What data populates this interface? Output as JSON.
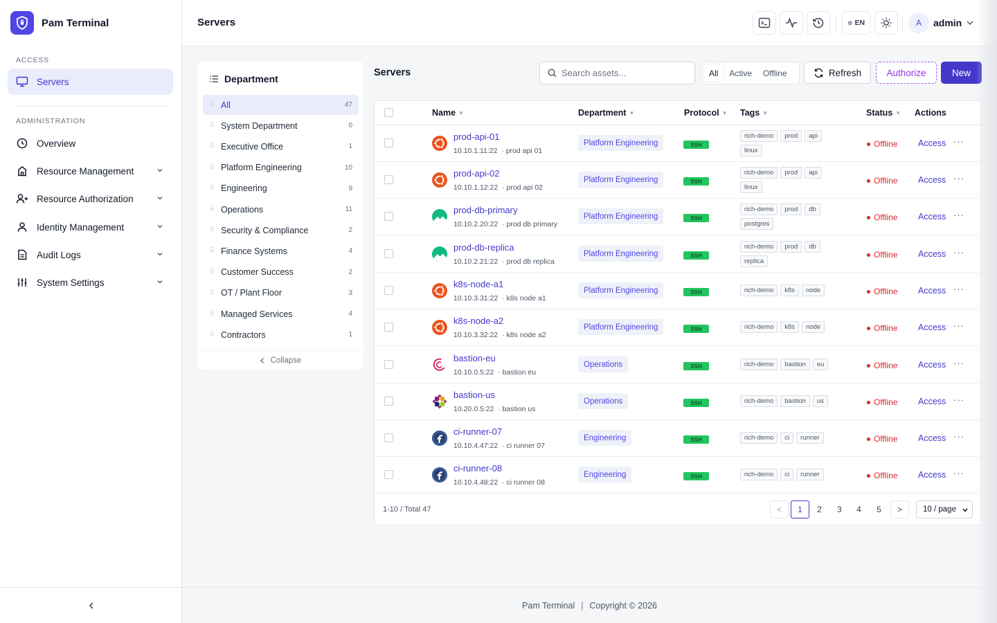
{
  "app": {
    "name": "Pam Terminal"
  },
  "sidebar": {
    "section_access": "ACCESS",
    "section_admin": "ADMINISTRATION",
    "servers_label": "Servers",
    "items": [
      {
        "label": "Overview"
      },
      {
        "label": "Resource Management"
      },
      {
        "label": "Resource Authorization"
      },
      {
        "label": "Identity Management"
      },
      {
        "label": "Audit Logs"
      },
      {
        "label": "System Settings"
      }
    ]
  },
  "header": {
    "title": "Servers",
    "lang": "EN",
    "avatar_letter": "A",
    "user": "admin"
  },
  "departments": {
    "title": "Department",
    "collapse_label": "Collapse",
    "items": [
      {
        "label": "All",
        "count": "47"
      },
      {
        "label": "System Department",
        "count": "0"
      },
      {
        "label": "Executive Office",
        "count": "1"
      },
      {
        "label": "Platform Engineering",
        "count": "10"
      },
      {
        "label": "Engineering",
        "count": "9"
      },
      {
        "label": "Operations",
        "count": "11"
      },
      {
        "label": "Security & Compliance",
        "count": "2"
      },
      {
        "label": "Finance Systems",
        "count": "4"
      },
      {
        "label": "Customer Success",
        "count": "2"
      },
      {
        "label": "OT / Plant Floor",
        "count": "3"
      },
      {
        "label": "Managed Services",
        "count": "4"
      },
      {
        "label": "Contractors",
        "count": "1"
      }
    ]
  },
  "toolbar": {
    "title": "Servers",
    "search_placeholder": "Search assets...",
    "filters": [
      "All",
      "Active",
      "Offline"
    ],
    "refresh_label": "Refresh",
    "authorize_label": "Authorize",
    "new_label": "New"
  },
  "table": {
    "columns": [
      "Name",
      "Department",
      "Protocol",
      "Tags",
      "Status",
      "Actions"
    ],
    "rows": [
      {
        "name": "prod-api-01",
        "ip": "10.10.1.11:22",
        "desc": "prod api 01",
        "os": "ubuntu",
        "department": "Platform Engineering",
        "protocol": "SSH",
        "tags": [
          "rich-demo",
          "prod",
          "api",
          "linux"
        ],
        "status": "Offline",
        "action": "Access"
      },
      {
        "name": "prod-api-02",
        "ip": "10.10.1.12:22",
        "desc": "prod api 02",
        "os": "ubuntu",
        "department": "Platform Engineering",
        "protocol": "SSH",
        "tags": [
          "rich-demo",
          "prod",
          "api",
          "linux"
        ],
        "status": "Offline",
        "action": "Access"
      },
      {
        "name": "prod-db-primary",
        "ip": "10.10.2.20:22",
        "desc": "prod db primary",
        "os": "rocky",
        "department": "Platform Engineering",
        "protocol": "SSH",
        "tags": [
          "rich-demo",
          "prod",
          "db",
          "postgres"
        ],
        "status": "Offline",
        "action": "Access"
      },
      {
        "name": "prod-db-replica",
        "ip": "10.10.2.21:22",
        "desc": "prod db replica",
        "os": "rocky",
        "department": "Platform Engineering",
        "protocol": "SSH",
        "tags": [
          "rich-demo",
          "prod",
          "db",
          "replica"
        ],
        "status": "Offline",
        "action": "Access"
      },
      {
        "name": "k8s-node-a1",
        "ip": "10.10.3.31:22",
        "desc": "k8s node a1",
        "os": "ubuntu",
        "department": "Platform Engineering",
        "protocol": "SSH",
        "tags": [
          "rich-demo",
          "k8s",
          "node"
        ],
        "status": "Offline",
        "action": "Access"
      },
      {
        "name": "k8s-node-a2",
        "ip": "10.10.3.32:22",
        "desc": "k8s node a2",
        "os": "ubuntu",
        "department": "Platform Engineering",
        "protocol": "SSH",
        "tags": [
          "rich-demo",
          "k8s",
          "node"
        ],
        "status": "Offline",
        "action": "Access"
      },
      {
        "name": "bastion-eu",
        "ip": "10.10.0.5:22",
        "desc": "bastion eu",
        "os": "debian",
        "department": "Operations",
        "protocol": "SSH",
        "tags": [
          "rich-demo",
          "bastion",
          "eu"
        ],
        "status": "Offline",
        "action": "Access"
      },
      {
        "name": "bastion-us",
        "ip": "10.20.0.5:22",
        "desc": "bastion us",
        "os": "centos",
        "department": "Operations",
        "protocol": "SSH",
        "tags": [
          "rich-demo",
          "bastion",
          "us"
        ],
        "status": "Offline",
        "action": "Access"
      },
      {
        "name": "ci-runner-07",
        "ip": "10.10.4.47:22",
        "desc": "ci runner 07",
        "os": "fedora",
        "department": "Engineering",
        "protocol": "SSH",
        "tags": [
          "rich-demo",
          "ci",
          "runner"
        ],
        "status": "Offline",
        "action": "Access"
      },
      {
        "name": "ci-runner-08",
        "ip": "10.10.4.48:22",
        "desc": "ci runner 08",
        "os": "fedora",
        "department": "Engineering",
        "protocol": "SSH",
        "tags": [
          "rich-demo",
          "ci",
          "runner"
        ],
        "status": "Offline",
        "action": "Access"
      }
    ]
  },
  "pagination": {
    "total_text": "1-10 / Total 47",
    "prev": "<",
    "next": ">",
    "pages": [
      "1",
      "2",
      "3",
      "4",
      "5"
    ],
    "current": "1",
    "page_size": "10 / page"
  },
  "footer": {
    "brand": "Pam Terminal",
    "separator": "|",
    "copyright": "Copyright © 2026"
  },
  "colors": {
    "accent": "#4338ca",
    "offline": "#dc2626",
    "ssh": "#22c55e",
    "authorize": "#9333ea"
  }
}
